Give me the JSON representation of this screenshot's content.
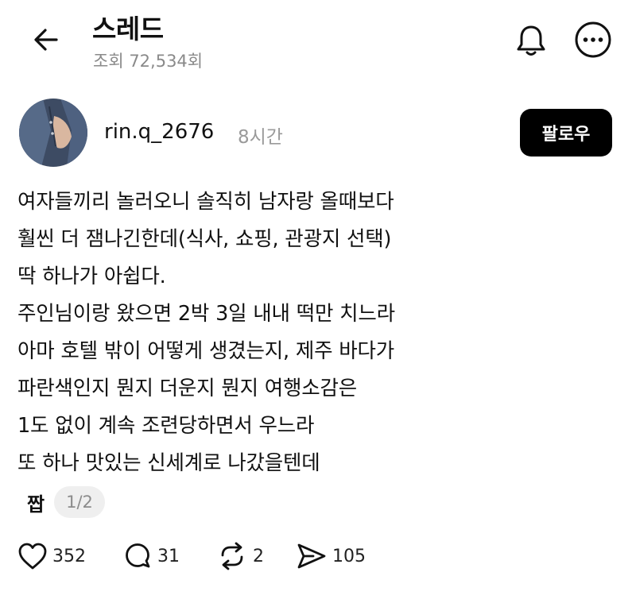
{
  "header": {
    "title": "스레드",
    "views": "조회 72,534회"
  },
  "post": {
    "username": "rin.q_2676",
    "time_ago": "8시간",
    "follow_label": "팔로우",
    "lines": [
      "여자들끼리 놀러오니 솔직히 남자랑 올때보다",
      "훨씬 더 잼나긴한데(식사, 쇼핑, 관광지 선택)",
      "딱 하나가 아쉽다.",
      "주인님이랑 왔으면 2박 3일 내내 떡만 치느라",
      "아마 호텔 밖이 어떻게 생겼는지, 제주 바다가",
      "파란색인지 뭔지 더운지 뭔지 여행소감은",
      "1도 없이 계속 조련당하면서 우느라",
      "또 하나 맛있는 신세계로 나갔을텐데"
    ],
    "attachment_label": "짭",
    "page_indicator": "1/2"
  },
  "actions": {
    "likes": "352",
    "replies": "31",
    "reposts": "2",
    "shares": "105"
  },
  "colors": {
    "text": "#111111",
    "muted": "#8a8a8a",
    "follow_bg": "#000000",
    "pill_bg": "#efefef"
  },
  "icons": [
    "back-arrow-icon",
    "bell-icon",
    "more-icon",
    "heart-icon",
    "comment-icon",
    "repost-icon",
    "share-icon"
  ]
}
